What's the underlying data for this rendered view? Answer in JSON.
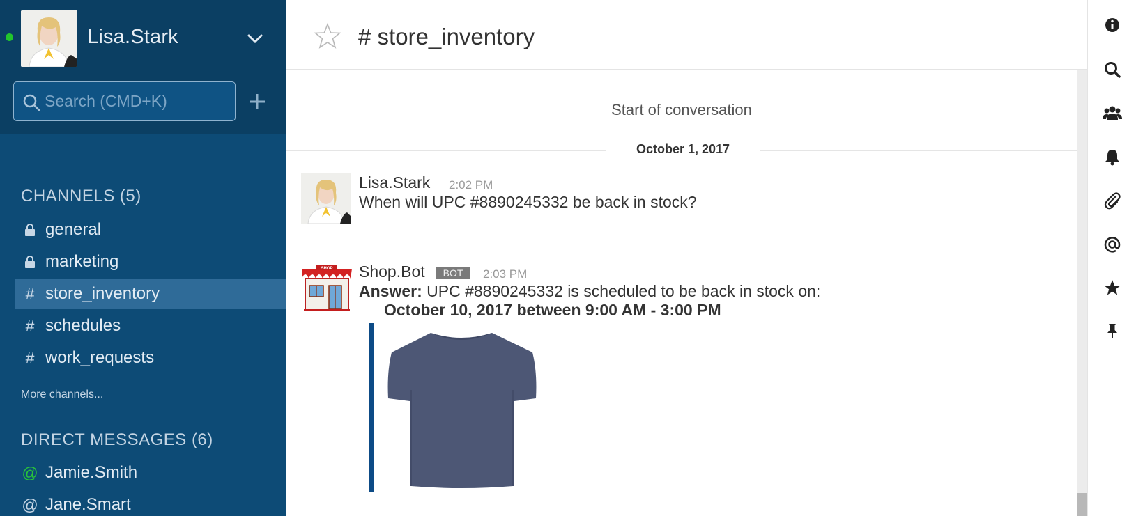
{
  "user": {
    "name": "Lisa.Stark",
    "status_color": "#22c52c"
  },
  "search": {
    "placeholder": "Search (CMD+K)"
  },
  "channels": {
    "title": "CHANNELS (5)",
    "items": [
      {
        "prefix": "lock-icon",
        "label": "general"
      },
      {
        "prefix": "lock-icon",
        "label": "marketing"
      },
      {
        "prefix": "#",
        "label": "store_inventory",
        "active": true
      },
      {
        "prefix": "#",
        "label": "schedules"
      },
      {
        "prefix": "#",
        "label": "work_requests"
      }
    ],
    "more": "More channels..."
  },
  "direct_messages": {
    "title": "DIRECT MESSAGES (6)",
    "items": [
      {
        "prefix": "@",
        "label": "Jamie.Smith",
        "online": true
      },
      {
        "prefix": "@",
        "label": "Jane.Smart",
        "online": false
      }
    ]
  },
  "header": {
    "channel_title": "# store_inventory"
  },
  "conversation": {
    "start_label": "Start of conversation",
    "date_label": "October 1, 2017",
    "messages": [
      {
        "author": "Lisa.Stark",
        "time": "2:02 PM",
        "text": "When will UPC #8890245332 be back in stock?"
      },
      {
        "author": "Shop.Bot",
        "badge": "BOT",
        "time": "2:03 PM",
        "answer_label": "Answer:",
        "text": " UPC #8890245332 is scheduled to be back in stock on:",
        "detail": "October 10, 2017 between 9:00 AM - 3:00 PM",
        "avatar_sign": "SHOP"
      }
    ]
  },
  "colors": {
    "sidebar_bg": "#0d4b76",
    "sidebar_header_bg": "#0b3f63",
    "active_channel": "#2f6b98",
    "attachment_bar": "#0d4b86"
  }
}
